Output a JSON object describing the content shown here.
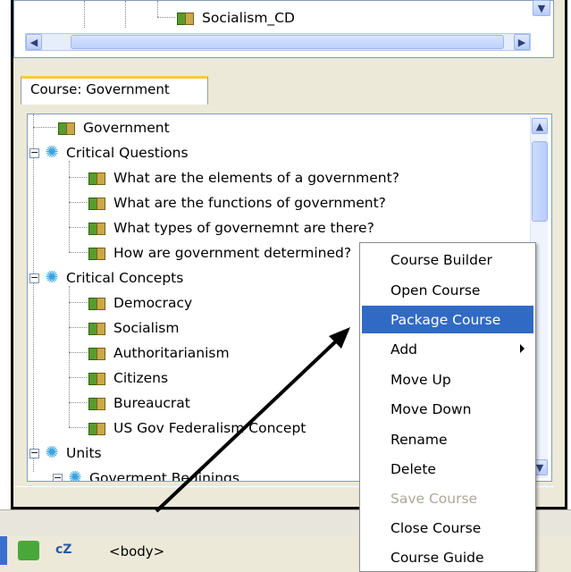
{
  "top_tree": {
    "visible_item": "Socialism_CD"
  },
  "tab": {
    "label": "Course: Government"
  },
  "tree": {
    "root": "Government",
    "critical_questions": {
      "label": "Critical Questions",
      "items": [
        "What are the elements of a government?",
        "What are the functions of government?",
        "What types of governemnt are there?",
        "How are government determined?"
      ]
    },
    "critical_concepts": {
      "label": "Critical Concepts",
      "items": [
        "Democracy",
        "Socialism",
        "Authoritarianism",
        "Citizens",
        "Bureaucrat",
        "US Gov Federalism Concept"
      ]
    },
    "units": {
      "label": "Units",
      "child": "Goverment Beginings"
    }
  },
  "context_menu": {
    "items": [
      {
        "label": "Course Builder",
        "state": "normal"
      },
      {
        "label": "Open Course",
        "state": "normal"
      },
      {
        "label": "Package Course",
        "state": "highlighted"
      },
      {
        "label": "Add",
        "state": "submenu"
      },
      {
        "label": "Move Up",
        "state": "normal"
      },
      {
        "label": "Move Down",
        "state": "normal"
      },
      {
        "label": "Rename",
        "state": "normal"
      },
      {
        "label": "Delete",
        "state": "normal"
      },
      {
        "label": "Save Course",
        "state": "disabled"
      },
      {
        "label": "Close Course",
        "state": "normal"
      },
      {
        "label": "Course Guide",
        "state": "normal"
      }
    ]
  },
  "bottom": {
    "tag_label": "<body>",
    "cz_label": "cZ"
  },
  "colors": {
    "highlight": "#316ac5",
    "window_bg": "#ece9d8",
    "gear": "#3aa4e0"
  }
}
